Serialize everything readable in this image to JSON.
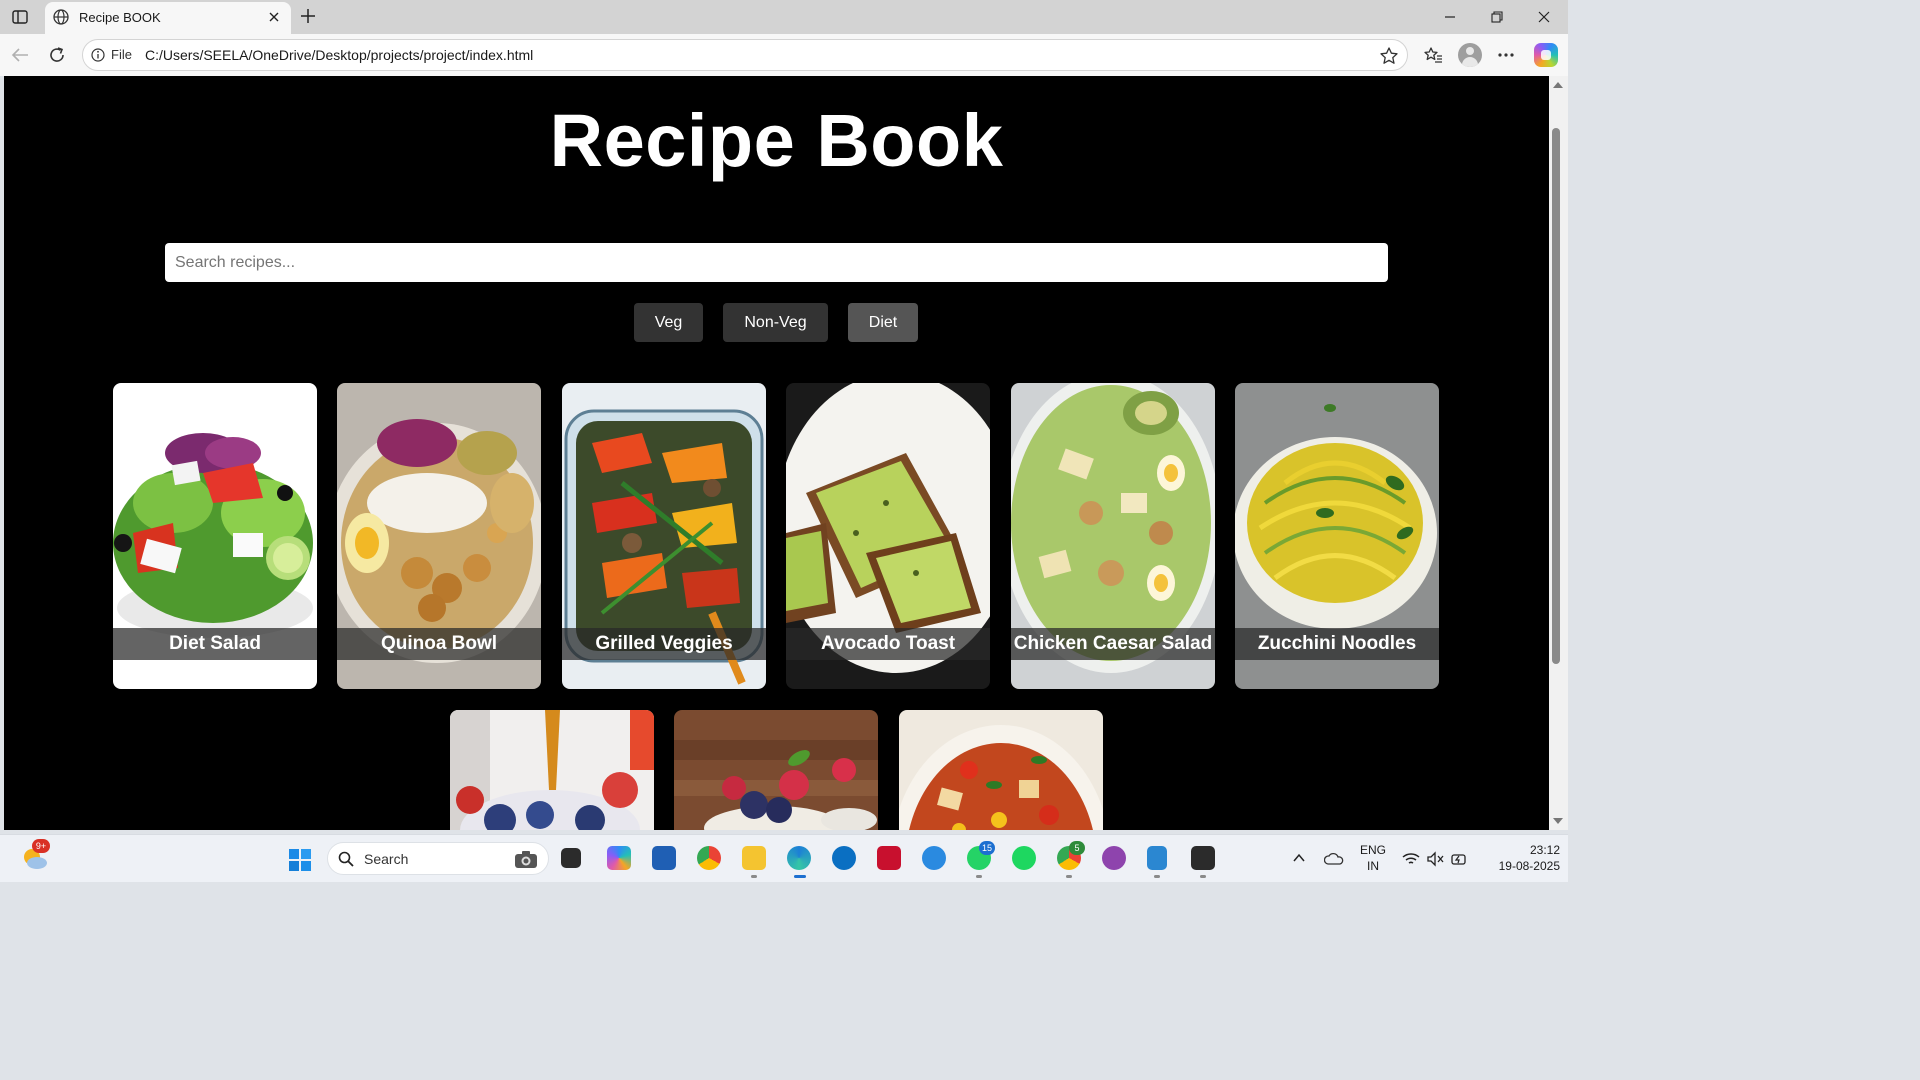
{
  "browser": {
    "tab_title": "Recipe BOOK",
    "address_scheme": "File",
    "address_url": "C:/Users/SEELA/OneDrive/Desktop/projects/project/index.html"
  },
  "page": {
    "title": "Recipe Book",
    "search_placeholder": "Search recipes...",
    "filters": [
      "Veg",
      "Non-Veg",
      "Diet"
    ],
    "active_filter": "Diet",
    "recipes": [
      {
        "name": "Diet Salad",
        "icon": "salad-image"
      },
      {
        "name": "Quinoa Bowl",
        "icon": "quinoa-bowl-image"
      },
      {
        "name": "Grilled Veggies",
        "icon": "grilled-veggies-image"
      },
      {
        "name": "Avocado Toast",
        "icon": "avocado-toast-image"
      },
      {
        "name": "Chicken Caesar Salad",
        "icon": "caesar-salad-image"
      },
      {
        "name": "Zucchini Noodles",
        "icon": "zucchini-noodles-image"
      },
      {
        "name": "",
        "icon": "honey-berry-parfait-image"
      },
      {
        "name": "",
        "icon": "berry-yogurt-cup-image"
      },
      {
        "name": "",
        "icon": "vegetable-soup-image"
      }
    ]
  },
  "taskbar": {
    "weather_badge": "9+",
    "search_label": "Search",
    "whatsapp_badge": "15",
    "chrome_badge": "5",
    "language": "ENG",
    "region": "IN",
    "time": "23:12",
    "date": "19-08-2025"
  },
  "colors": {
    "page_background": "#000000",
    "filter_button": "#333333",
    "filter_button_active": "#555555",
    "card_label_overlay": "rgba(40,40,40,0.72)"
  }
}
